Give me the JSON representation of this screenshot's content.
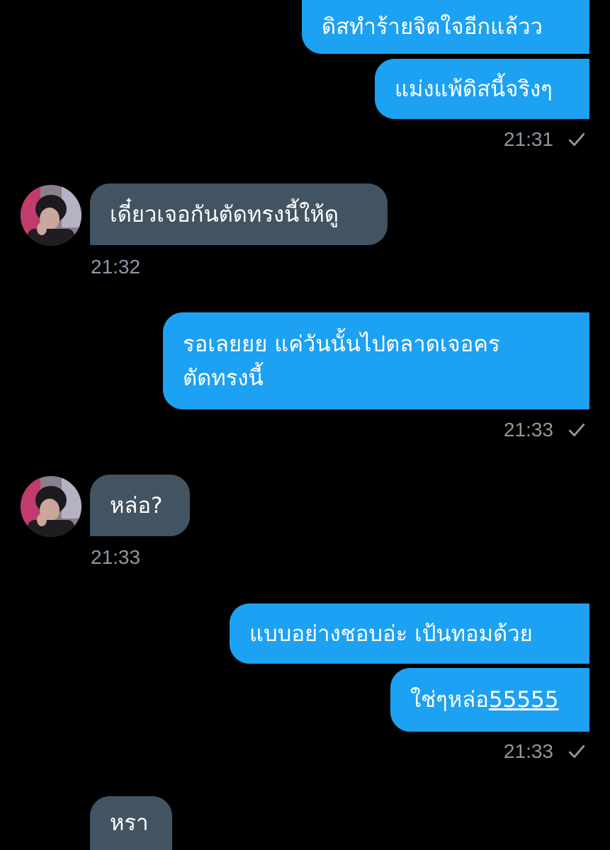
{
  "conversation": {
    "messages": [
      {
        "sender": "me",
        "text": "ดิสทำร้ายจิตใจอีกแล้วว"
      },
      {
        "sender": "me",
        "text": "แม่งแพ้ดิสนี้จริงๆ"
      },
      {
        "sender": "me",
        "time": "21:31",
        "status": "sent"
      },
      {
        "sender": "them",
        "text": "เดี๋ยวเจอกันตัดทรงนี้ให้ดู",
        "time": "21:32"
      },
      {
        "sender": "me",
        "text_line1": "รอเลยยย แค่วันนั้นไปตลาดเจอคร",
        "text_line2": "ตัดทรงนี้",
        "time": "21:33",
        "status": "sent"
      },
      {
        "sender": "them",
        "text": "หล่อ?",
        "time": "21:33"
      },
      {
        "sender": "me",
        "text": "แบบอย่างชอบอ่ะ เป้นทอมด้วย"
      },
      {
        "sender": "me",
        "text_prefix": "ใช่ๆหล่อ",
        "text_link": "55555",
        "time": "21:33",
        "status": "sent"
      },
      {
        "sender": "them",
        "text": "หรา"
      }
    ]
  },
  "colors": {
    "background": "#000000",
    "outgoing_bubble": "#1da1f2",
    "incoming_bubble": "#425361",
    "timestamp": "#8b98a5",
    "text": "#ffffff"
  },
  "icons": {
    "read_receipt": "check-icon",
    "contact_avatar": "avatar"
  }
}
